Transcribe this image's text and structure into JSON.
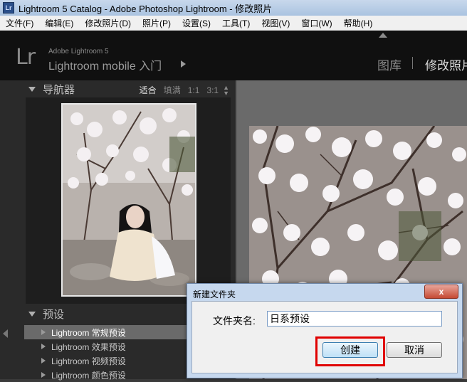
{
  "window": {
    "title": "Lightroom 5 Catalog - Adobe Photoshop Lightroom - 修改照片",
    "app_icon": "Lr"
  },
  "menu": [
    "文件(F)",
    "编辑(E)",
    "修改照片(D)",
    "照片(P)",
    "设置(S)",
    "工具(T)",
    "视图(V)",
    "窗口(W)",
    "帮助(H)"
  ],
  "identity": {
    "logo": "Lr",
    "small": "Adobe Lightroom 5",
    "big": "Lightroom mobile 入门"
  },
  "modules": {
    "library": "图库",
    "develop": "修改照片"
  },
  "navigator": {
    "title": "导航器",
    "zoom": [
      "适合",
      "填满",
      "1:1",
      "3:1"
    ],
    "active_zoom": "适合"
  },
  "presets": {
    "title": "预设",
    "items": [
      "Lightroom 常规预设",
      "Lightroom 效果预设",
      "Lightroom 视频预设",
      "Lightroom 颜色预设"
    ],
    "selected_index": 0
  },
  "dialog": {
    "title": "新建文件夹",
    "field_label": "文件夹名:",
    "field_value": "日系预设",
    "create": "创建",
    "cancel": "取消",
    "close": "x"
  },
  "colors": {
    "highlight": "#e00000",
    "selected_row": "#6a6a6a"
  }
}
